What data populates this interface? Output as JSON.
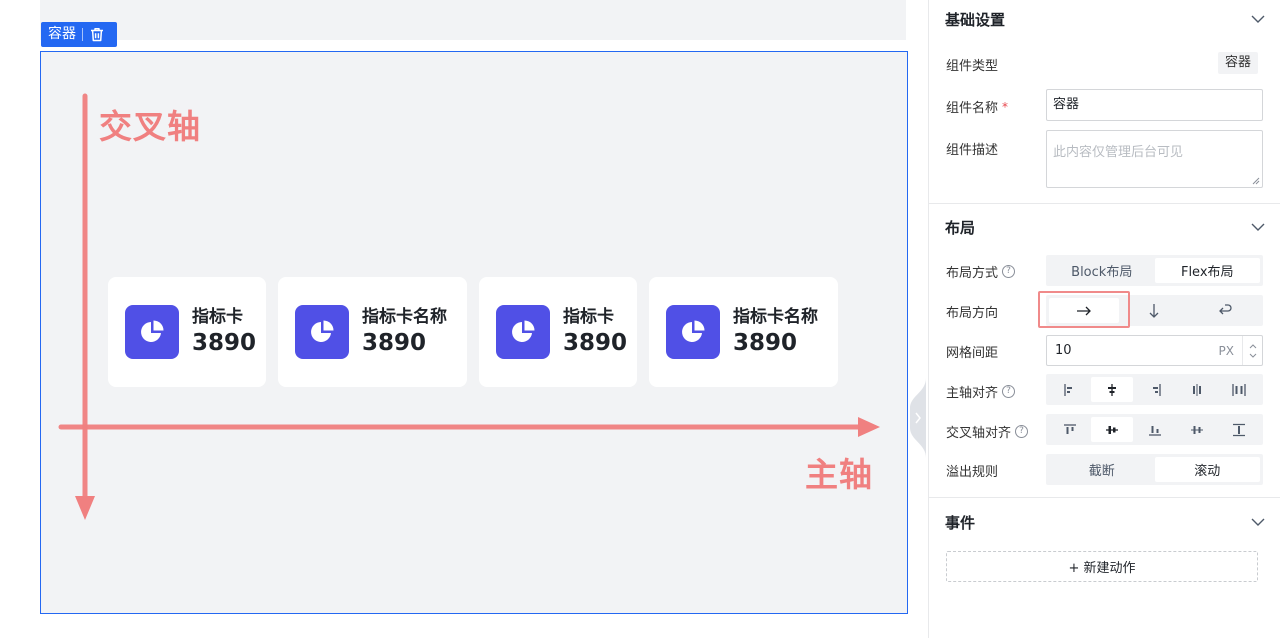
{
  "canvas": {
    "badge_label": "容器",
    "cross_axis_label": "交叉轴",
    "main_axis_label": "主轴",
    "axis_color": "#f08080",
    "cards": [
      {
        "title": "指标卡",
        "value": "3890"
      },
      {
        "title": "指标卡名称",
        "value": "3890"
      },
      {
        "title": "指标卡",
        "value": "3890"
      },
      {
        "title": "指标卡名称",
        "value": "3890"
      }
    ],
    "card_icon": "pie-chart-icon",
    "card_icon_color": "#5050e6"
  },
  "panel": {
    "basic": {
      "title": "基础设置",
      "type_label": "组件类型",
      "type_value": "容器",
      "name_label": "组件名称",
      "name_required": "*",
      "name_value": "容器",
      "desc_label": "组件描述",
      "desc_placeholder": "此内容仅管理后台可见"
    },
    "layout": {
      "title": "布局",
      "mode_label": "布局方式",
      "mode_options": [
        "Block布局",
        "Flex布局"
      ],
      "mode_selected": "Flex布局",
      "direction_label": "布局方向",
      "direction_options": [
        "arrow-right-icon",
        "arrow-down-icon",
        "wrap-return-icon"
      ],
      "direction_selected": "arrow-right-icon",
      "gap_label": "网格间距",
      "gap_value": "10",
      "gap_unit": "PX",
      "main_align_label": "主轴对齐",
      "main_align_selected": 1,
      "cross_align_label": "交叉轴对齐",
      "cross_align_selected": 1,
      "overflow_label": "溢出规则",
      "overflow_options": [
        "截断",
        "滚动"
      ],
      "overflow_selected": "滚动"
    },
    "events": {
      "title": "事件",
      "add_action_label": "+ 新建动作"
    },
    "accent_color": "#2468f2"
  }
}
